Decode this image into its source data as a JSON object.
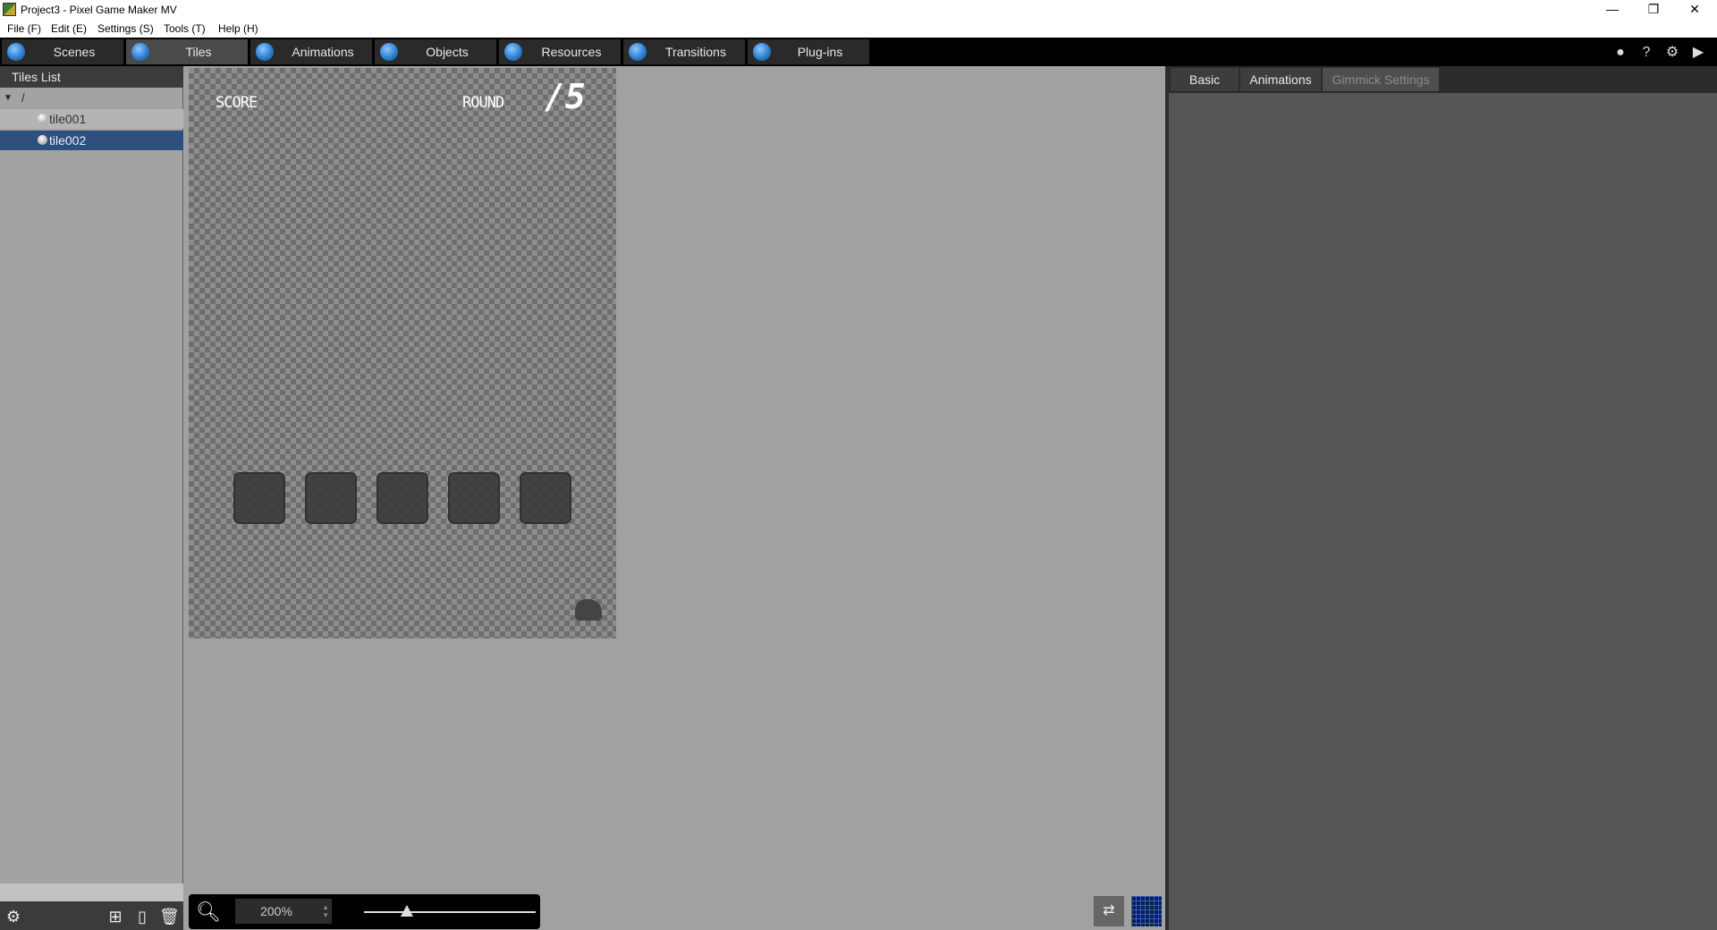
{
  "window": {
    "title": "Project3 - Pixel Game Maker MV",
    "minimize": "—",
    "restore": "❐",
    "close": "✕"
  },
  "menu": [
    "File (F)",
    "Edit (E)",
    "Settings (S)",
    "Tools (T)",
    "Help (H)"
  ],
  "toolbar": {
    "tabs": [
      "Scenes",
      "Tiles",
      "Animations",
      "Objects",
      "Resources",
      "Transitions",
      "Plug-ins"
    ],
    "active": "Tiles",
    "right_icons": [
      "circle-icon",
      "help-icon",
      "gear-icon",
      "play-icon"
    ]
  },
  "tiles_panel": {
    "header": "Tiles List",
    "root": "/",
    "items": [
      "tile001",
      "tile002"
    ],
    "selected": "tile002"
  },
  "canvas": {
    "hud_score": "SCORE",
    "hud_round": "ROUND",
    "hud_fraction": "/5",
    "slot_count": 5
  },
  "zoom": {
    "value": "200%",
    "slider_fraction": 0.25
  },
  "properties_tabs": {
    "tabs": [
      "Basic",
      "Animations",
      "Gimmick Settings"
    ],
    "active": "Basic",
    "disabled": "Gimmick Settings"
  },
  "colors": {
    "selected_row": "#2d4f7d",
    "accent_blue": "#2d7fd0",
    "toolbar_bg": "#000000"
  }
}
